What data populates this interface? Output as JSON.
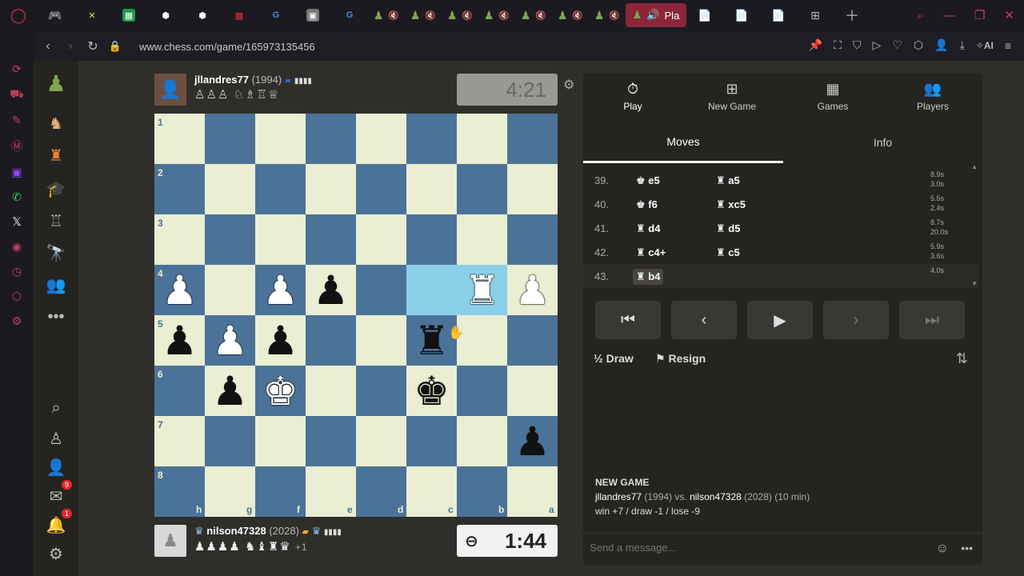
{
  "browser": {
    "url": "www.chess.com/game/165973135456",
    "active_tab_label": "Pla"
  },
  "sidebar": {
    "mail_badge": "9",
    "bell_badge": "1"
  },
  "top_player": {
    "name": "jllandres77",
    "rating": "(1994)",
    "captured": "♙♙♙ ♘♗♖♕",
    "clock": "4:21"
  },
  "bottom_player": {
    "name": "nilson47328",
    "rating": "(2028)",
    "captured": "♟♟♟♟ ♞♝♜♛",
    "extra": "+1",
    "clock": "1:44"
  },
  "board": {
    "ranks": [
      "1",
      "2",
      "3",
      "4",
      "5",
      "6",
      "7",
      "8"
    ],
    "files": [
      "h",
      "g",
      "f",
      "e",
      "d",
      "c",
      "b",
      "a"
    ],
    "highlight": [
      [
        3,
        5
      ],
      [
        3,
        6
      ]
    ],
    "pieces": [
      {
        "r": 3,
        "c": 0,
        "glyph": "♟",
        "color": "w"
      },
      {
        "r": 3,
        "c": 2,
        "glyph": "♟",
        "color": "w"
      },
      {
        "r": 3,
        "c": 3,
        "glyph": "♟",
        "color": "b"
      },
      {
        "r": 3,
        "c": 6,
        "glyph": "♜",
        "color": "w"
      },
      {
        "r": 3,
        "c": 7,
        "glyph": "♟",
        "color": "w"
      },
      {
        "r": 4,
        "c": 0,
        "glyph": "♟",
        "color": "b"
      },
      {
        "r": 4,
        "c": 1,
        "glyph": "♟",
        "color": "w"
      },
      {
        "r": 4,
        "c": 2,
        "glyph": "♟",
        "color": "b"
      },
      {
        "r": 4,
        "c": 5,
        "glyph": "♜",
        "color": "b"
      },
      {
        "r": 5,
        "c": 1,
        "glyph": "♟",
        "color": "b"
      },
      {
        "r": 5,
        "c": 2,
        "glyph": "♚",
        "color": "w"
      },
      {
        "r": 5,
        "c": 5,
        "glyph": "♚",
        "color": "b"
      },
      {
        "r": 6,
        "c": 7,
        "glyph": "♟",
        "color": "b"
      }
    ]
  },
  "panel": {
    "tabs": [
      {
        "label": "Play",
        "icon": "⏱"
      },
      {
        "label": "New Game",
        "icon": "⊞"
      },
      {
        "label": "Games",
        "icon": "▦"
      },
      {
        "label": "Players",
        "icon": "👥"
      }
    ],
    "subtabs": [
      "Moves",
      "Info"
    ],
    "moves": [
      {
        "num": "39.",
        "white": "♚ e5",
        "black": "♜ a5",
        "t1": "8.9s",
        "t2": "3.0s"
      },
      {
        "num": "40.",
        "white": "♚ f6",
        "black": "♜ xc5",
        "t1": "5.5s",
        "t2": "2.4s"
      },
      {
        "num": "41.",
        "white": "♜ d4",
        "black": "♜ d5",
        "t1": "8.7s",
        "t2": "20.0s"
      },
      {
        "num": "42.",
        "white": "♜ c4+",
        "black": "♜ c5",
        "t1": "5.9s",
        "t2": "3.6s"
      },
      {
        "num": "43.",
        "white": "♜ b4",
        "black": "",
        "t1": "4.0s",
        "t2": ""
      }
    ],
    "draw_label": "Draw",
    "resign_label": "Resign",
    "new_game_title": "NEW GAME",
    "new_game_p1": "jllandres77",
    "new_game_p1_rating": "(1994) vs.",
    "new_game_p2": "nilson47328",
    "new_game_p2_rating": "(2028) (10 min)",
    "new_game_stakes": "win +7 / draw -1 / lose -9",
    "chat_placeholder": "Send a message..."
  }
}
